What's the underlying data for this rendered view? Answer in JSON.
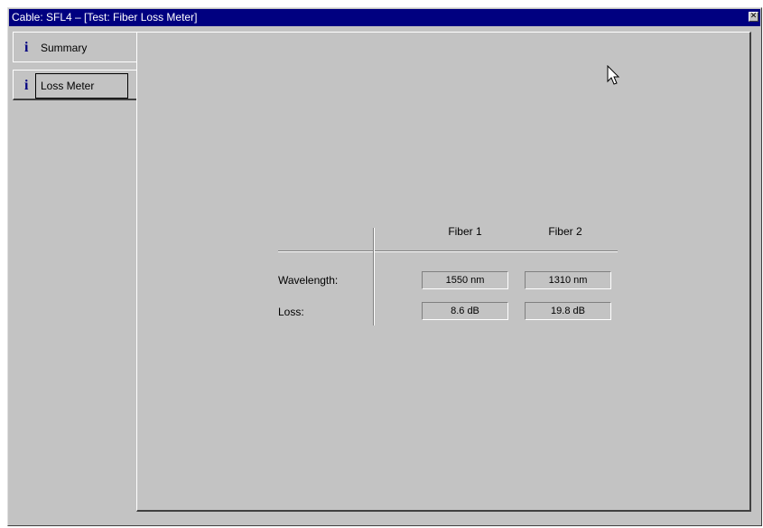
{
  "window": {
    "title": "Cable: SFL4 – [Test: Fiber Loss Meter]"
  },
  "tabs": [
    {
      "label": "Summary",
      "icon": "info-icon"
    },
    {
      "label": "Loss Meter",
      "icon": "info-icon"
    }
  ],
  "table": {
    "columns": [
      "Fiber 1",
      "Fiber 2"
    ],
    "rows": [
      {
        "label": "Wavelength:",
        "values": [
          "1550 nm",
          "1310 nm"
        ]
      },
      {
        "label": "Loss:",
        "values": [
          "8.6 dB",
          "19.8 dB"
        ]
      }
    ]
  },
  "colors": {
    "titlebar": "#000080",
    "face": "#c3c3c3"
  }
}
